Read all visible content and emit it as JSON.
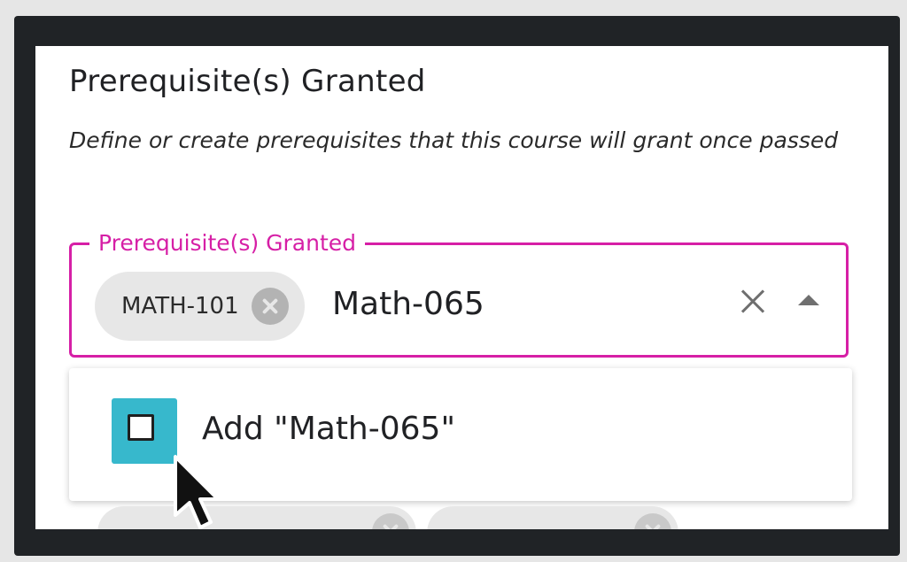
{
  "section": {
    "title": "Prerequisite(s) Granted",
    "description": "Define or create prerequisites that this course will grant once passed"
  },
  "field": {
    "label": "Prerequisite(s) Granted",
    "chips": [
      {
        "label": "MATH-101"
      }
    ],
    "input_value": "Math-065",
    "icons": {
      "clear": "close-icon",
      "toggle": "caret-up-icon"
    }
  },
  "dropdown": {
    "options": [
      {
        "label": "Add \"Math-065\"",
        "checked": false
      }
    ]
  },
  "colors": {
    "accent": "#d61fa6",
    "highlight": "#37b8cc",
    "chip_bg": "#e7e7e7",
    "frame": "#202326"
  }
}
